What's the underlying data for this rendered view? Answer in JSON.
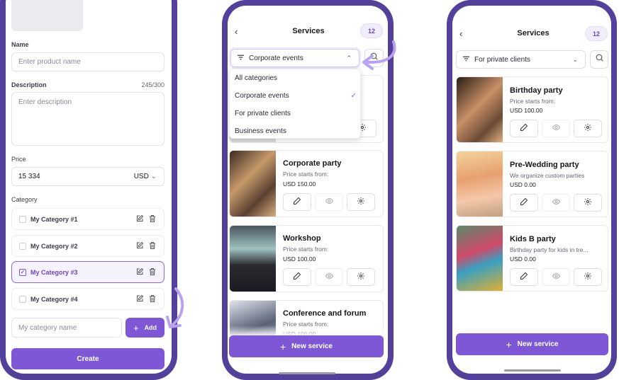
{
  "colors": {
    "frame": "#52409a",
    "accent": "#7e57d6",
    "arrow": "#b9a3f0"
  },
  "form": {
    "name_label": "Name",
    "name_placeholder": "Enter product name",
    "description_label": "Description",
    "description_counter": "245/300",
    "description_placeholder": "Enter description",
    "price_label": "Price",
    "price_value": "15 334",
    "currency": "USD",
    "category_label": "Category",
    "categories": [
      {
        "label": "My Category #1",
        "checked": false
      },
      {
        "label": "My Category #2",
        "checked": false
      },
      {
        "label": "My Category #3",
        "checked": true
      },
      {
        "label": "My Category #4",
        "checked": false
      }
    ],
    "new_category_placeholder": "My category name",
    "add_label": "Add",
    "create_label": "Create"
  },
  "services_a": {
    "title": "Services",
    "count": "12",
    "filter": "Corporate events",
    "dropdown": [
      {
        "label": "All categories",
        "selected": false
      },
      {
        "label": "Corporate events",
        "selected": true
      },
      {
        "label": "For private clients",
        "selected": false
      },
      {
        "label": "Business events",
        "selected": false
      }
    ],
    "cards": [
      {
        "title": "Corporate party",
        "subtitle": "Price starts from:",
        "price": "USD 150.00"
      },
      {
        "title": "Workshop",
        "subtitle": "Price starts from:",
        "price": "USD 100.00"
      },
      {
        "title": "Conference and forum",
        "subtitle": "Price starts from:",
        "price": "USD 100.00"
      }
    ],
    "new_service_label": "New service"
  },
  "services_b": {
    "title": "Services",
    "count": "12",
    "filter": "For private clients",
    "cards": [
      {
        "title": "Birthday party",
        "subtitle": "Price starts from:",
        "price": "USD 100.00"
      },
      {
        "title": "Pre-Wedding party",
        "subtitle": "We organize custom parties",
        "price": "USD 0.00"
      },
      {
        "title": "Kids B party",
        "subtitle": "Birthday party for kids in tre...",
        "price": "USD 0.00"
      }
    ],
    "new_service_label": "New service"
  }
}
